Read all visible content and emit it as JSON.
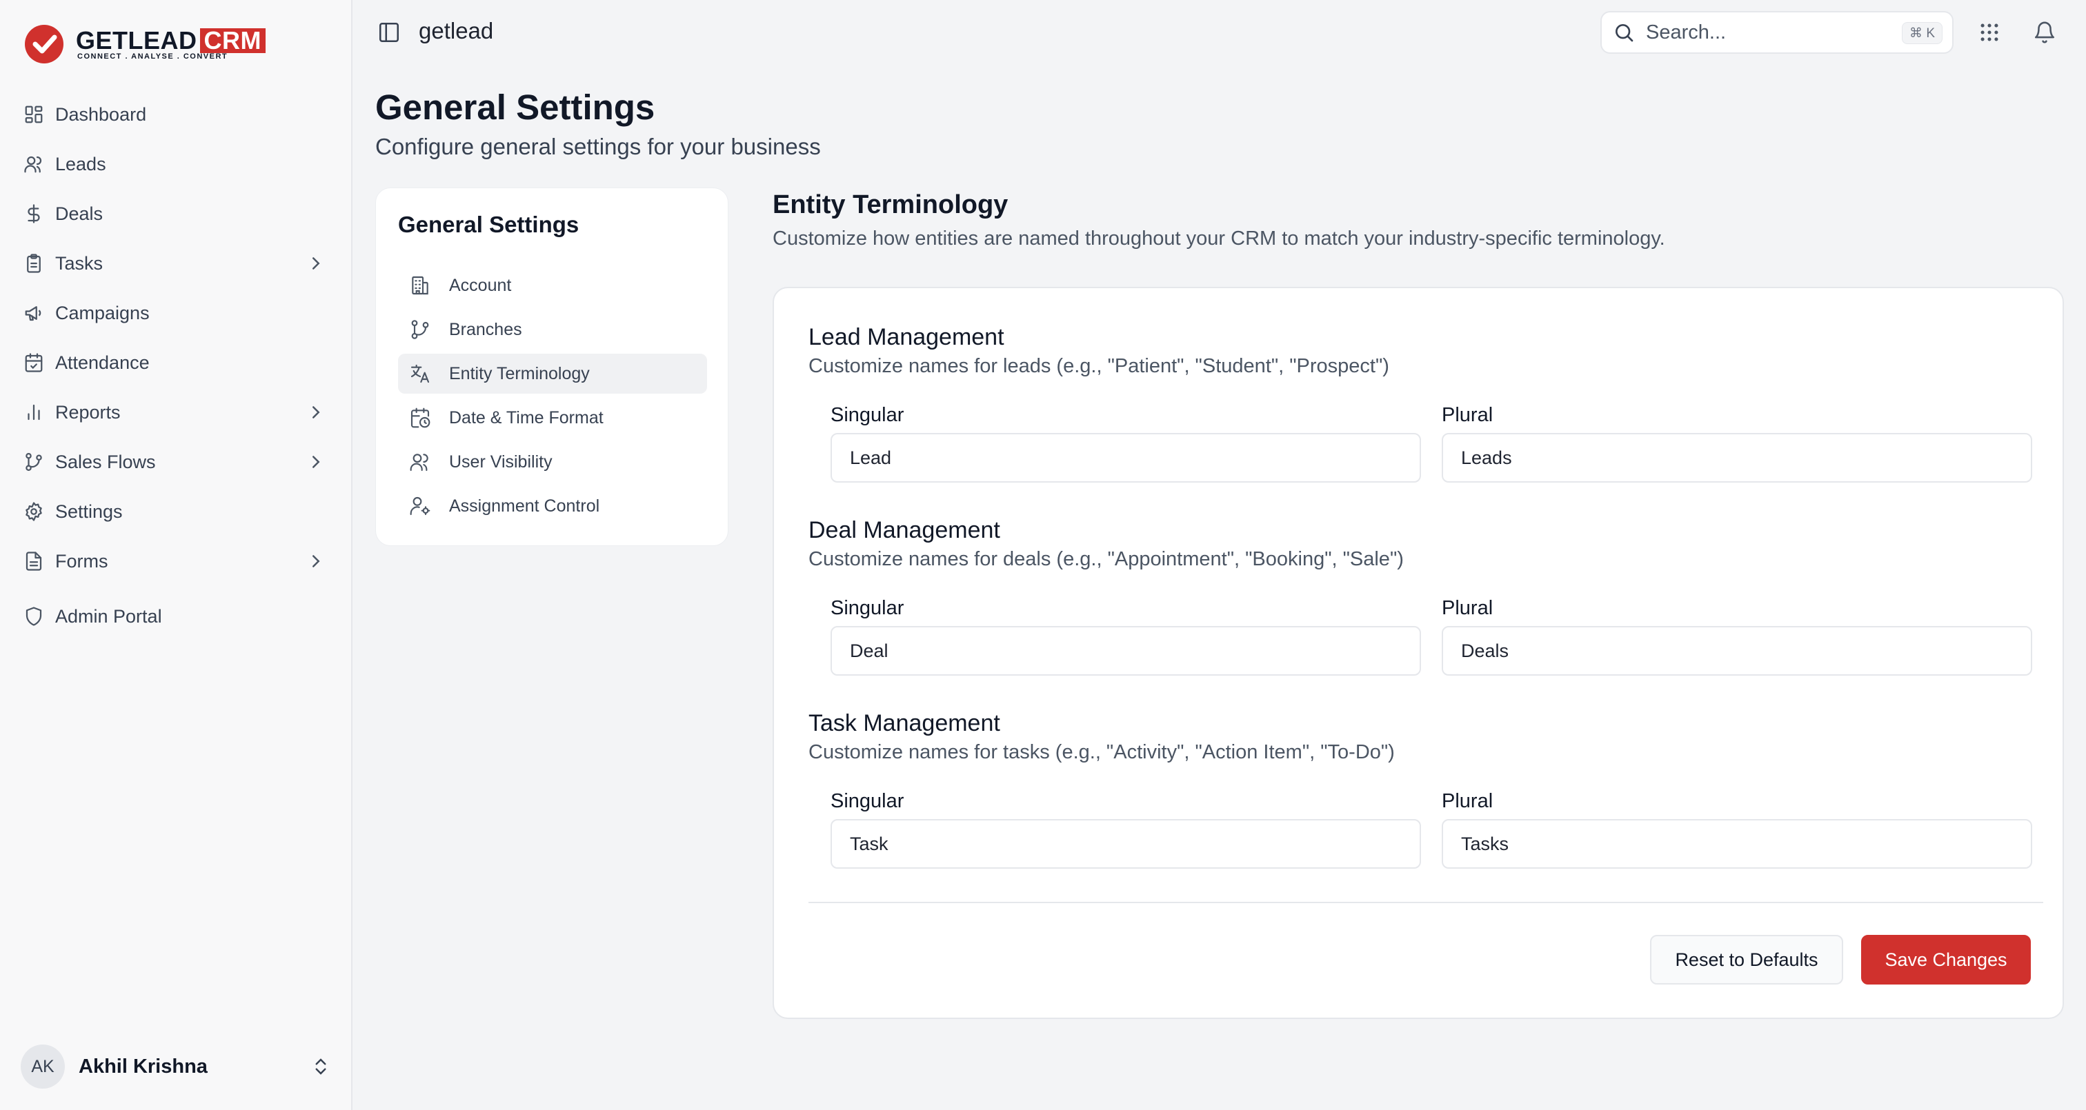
{
  "brand": {
    "word": "GETLEAD",
    "crm": "CRM",
    "tagline": "CONNECT  .  ANALYSE  .  CONVERT",
    "accent": "#d0312d"
  },
  "sidebar": {
    "items": [
      {
        "label": "Dashboard",
        "icon": "grid-icon"
      },
      {
        "label": "Leads",
        "icon": "users-icon"
      },
      {
        "label": "Deals",
        "icon": "dollar-icon"
      },
      {
        "label": "Tasks",
        "icon": "clipboard-icon",
        "has_children": true
      },
      {
        "label": "Campaigns",
        "icon": "megaphone-icon"
      },
      {
        "label": "Attendance",
        "icon": "calendar-check-icon"
      },
      {
        "label": "Reports",
        "icon": "bar-chart-icon",
        "has_children": true
      },
      {
        "label": "Sales Flows",
        "icon": "git-branch-icon",
        "has_children": true
      },
      {
        "label": "Settings",
        "icon": "gear-icon"
      },
      {
        "label": "Forms",
        "icon": "file-text-icon",
        "has_children": true
      }
    ],
    "admin_portal": {
      "label": "Admin Portal",
      "icon": "shield-icon"
    },
    "user": {
      "initials": "AK",
      "name": "Akhil Krishna"
    }
  },
  "topbar": {
    "org_name": "getlead",
    "search": {
      "placeholder": "Search...",
      "shortcut": "⌘ K"
    }
  },
  "page": {
    "title": "General Settings",
    "subtitle": "Configure general settings for your business"
  },
  "settings_nav": {
    "title": "General Settings",
    "items": [
      {
        "label": "Account",
        "icon": "building-icon",
        "active": false
      },
      {
        "label": "Branches",
        "icon": "git-branch-icon",
        "active": false
      },
      {
        "label": "Entity Terminology",
        "icon": "translate-icon",
        "active": true
      },
      {
        "label": "Date & Time Format",
        "icon": "calendar-clock-icon",
        "active": false
      },
      {
        "label": "User Visibility",
        "icon": "users-icon",
        "active": false
      },
      {
        "label": "Assignment Control",
        "icon": "user-cog-icon",
        "active": false
      }
    ]
  },
  "entity_terminology": {
    "title": "Entity Terminology",
    "subtitle": "Customize how entities are named throughout your CRM to match your industry-specific terminology.",
    "groups": [
      {
        "title": "Lead Management",
        "description": "Customize names for leads (e.g., \"Patient\", \"Student\", \"Prospect\")",
        "singular_label": "Singular",
        "singular_value": "Lead",
        "plural_label": "Plural",
        "plural_value": "Leads"
      },
      {
        "title": "Deal Management",
        "description": "Customize names for deals (e.g., \"Appointment\", \"Booking\", \"Sale\")",
        "singular_label": "Singular",
        "singular_value": "Deal",
        "plural_label": "Plural",
        "plural_value": "Deals"
      },
      {
        "title": "Task Management",
        "description": "Customize names for tasks (e.g., \"Activity\", \"Action Item\", \"To-Do\")",
        "singular_label": "Singular",
        "singular_value": "Task",
        "plural_label": "Plural",
        "plural_value": "Tasks"
      }
    ],
    "reset_label": "Reset to Defaults",
    "save_label": "Save Changes"
  }
}
